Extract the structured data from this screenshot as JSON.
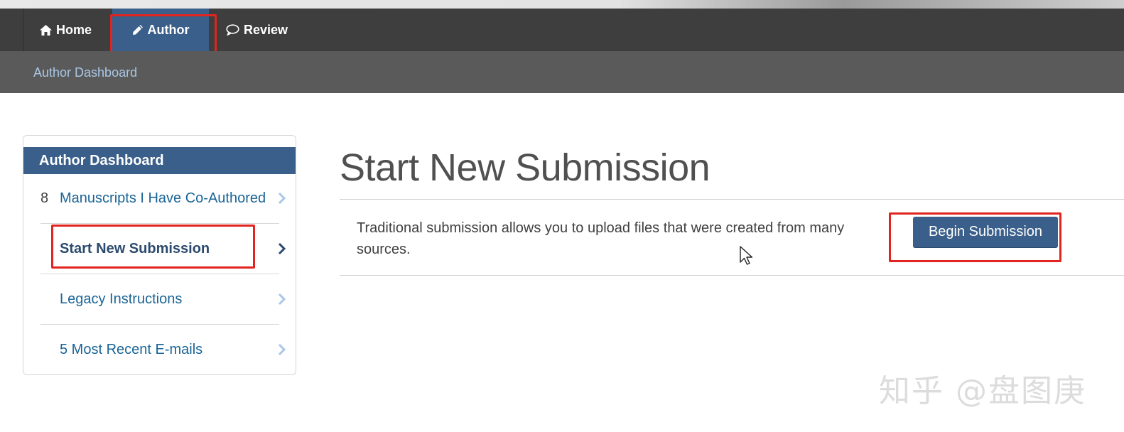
{
  "nav": {
    "items": [
      {
        "label": "Home",
        "icon": "home-icon"
      },
      {
        "label": "Author",
        "icon": "pencil-icon",
        "active": true
      },
      {
        "label": "Review",
        "icon": "speech-bubble-icon"
      }
    ],
    "breadcrumb": "Author Dashboard"
  },
  "sidebar": {
    "title": "Author Dashboard",
    "items": [
      {
        "count": "8",
        "label": "Manuscripts I Have Co-Authored"
      },
      {
        "count": "",
        "label": "Start New Submission",
        "active": true
      },
      {
        "count": "",
        "label": "Legacy Instructions"
      },
      {
        "count": "",
        "label": "5 Most Recent E-mails"
      }
    ]
  },
  "main": {
    "title": "Start New Submission",
    "description": "Traditional submission allows you to upload files that were created from many sources.",
    "begin_button": "Begin Submission"
  },
  "watermark": "知乎 @盘图庚",
  "colors": {
    "accent": "#3a5f8a",
    "link": "#1a6496",
    "highlight_box": "#e1241f",
    "navbar": "#3e3e3e"
  }
}
